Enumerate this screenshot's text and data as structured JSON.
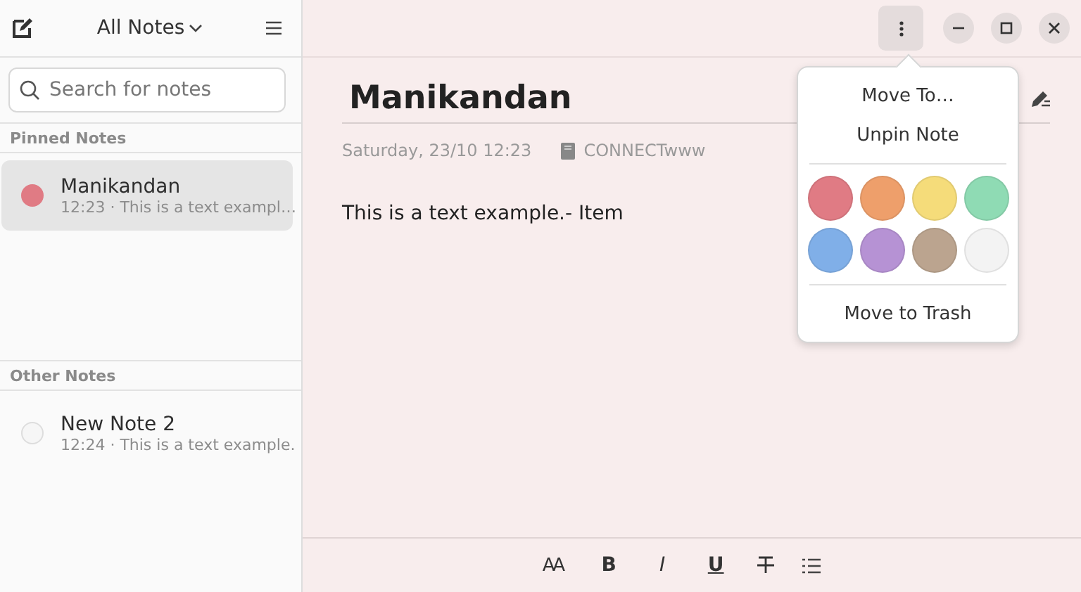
{
  "sidebar": {
    "title": "All Notes",
    "search": {
      "placeholder": "Search for notes"
    },
    "sections": [
      {
        "heading": "Pinned Notes",
        "notes": [
          {
            "title": "Manikandan",
            "preview": "12:23 · This is a text exampl…",
            "color": "#e07b84",
            "selected": true
          }
        ]
      },
      {
        "heading": "Other Notes",
        "notes": [
          {
            "title": "New Note 2",
            "preview": "12:24 · This is a text example.",
            "color": "#f6f6f6",
            "selected": false
          }
        ]
      }
    ]
  },
  "note": {
    "title": "Manikandan",
    "date": "Saturday, 23/10 12:23",
    "notebook": "CONNECTwww",
    "body": "This is a text example.- Item"
  },
  "menu": {
    "items": [
      "Move To…",
      "Unpin Note"
    ],
    "colors": [
      {
        "color": "#e07b84"
      },
      {
        "color": "#ee9f6b"
      },
      {
        "color": "#f5dc7a"
      },
      {
        "color": "#8fdbb4"
      },
      {
        "color": "#80afe8"
      },
      {
        "color": "#b692d4"
      },
      {
        "color": "#bba48f"
      },
      {
        "color": "#f3f3f3"
      }
    ],
    "trash": "Move to Trash"
  },
  "toolbar": [
    {
      "kind": "font",
      "label": "AA"
    },
    {
      "kind": "bold",
      "label": "B"
    },
    {
      "kind": "italic",
      "label": "I"
    },
    {
      "kind": "underline",
      "label": "U"
    },
    {
      "kind": "strike"
    },
    {
      "kind": "list"
    }
  ]
}
